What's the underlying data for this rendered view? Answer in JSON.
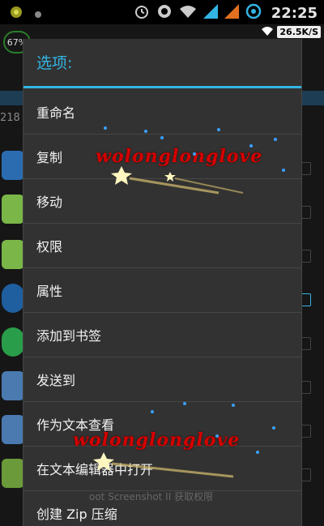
{
  "status_bar": {
    "time": "22:25",
    "icons": [
      "android-debug-icon",
      "dot-icon",
      "alarm-icon",
      "sync-icon",
      "wifi-icon",
      "signal-icon",
      "signal-icon-2",
      "data-icon"
    ]
  },
  "network": {
    "speed": "26.5K/S"
  },
  "background": {
    "battery_percent": "67%",
    "count_text": "218"
  },
  "dialog": {
    "title": "选项:",
    "items": [
      {
        "label": "重命名"
      },
      {
        "label": "复制"
      },
      {
        "label": "移动"
      },
      {
        "label": "权限"
      },
      {
        "label": "属性"
      },
      {
        "label": "添加到书签"
      },
      {
        "label": "发送到"
      },
      {
        "label": "作为文本查看"
      },
      {
        "label": "在文本编辑器中打开"
      },
      {
        "label": "创建 Zip 压缩"
      }
    ]
  },
  "watermark": {
    "text": "wolonglonglove"
  },
  "ghost": {
    "text": "oot Screenshot II 获取权限"
  },
  "colors": {
    "accent": "#33b5e5",
    "dialog_bg": "#323232",
    "watermark": "#d40000"
  }
}
